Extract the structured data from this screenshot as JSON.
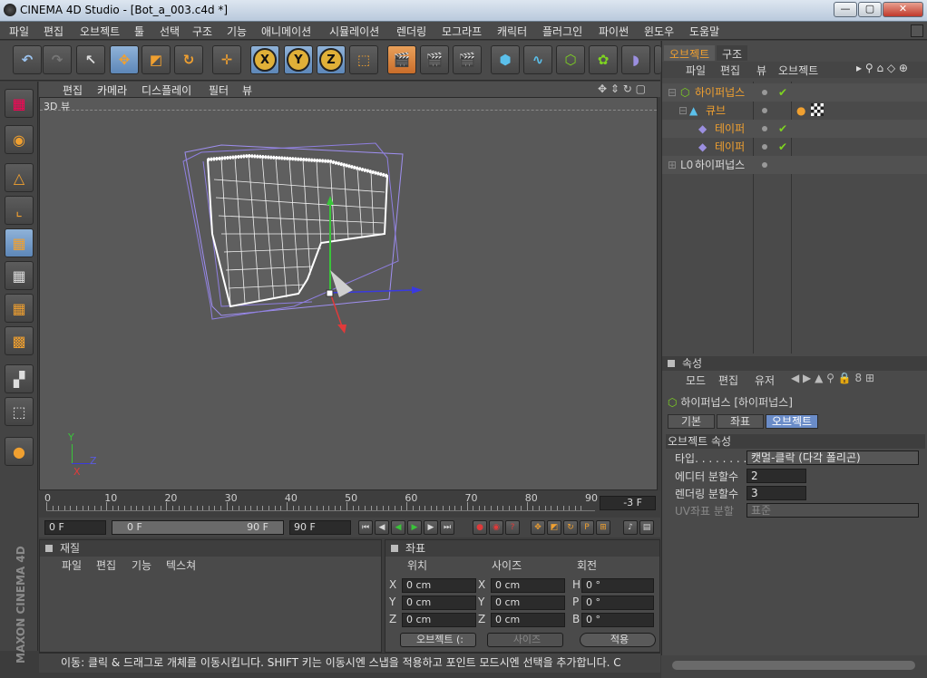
{
  "window": {
    "title": "CINEMA 4D Studio - [Bot_a_003.c4d *]",
    "minimize": "—",
    "maximize": "▢",
    "close": "✕"
  },
  "menu": [
    "파일",
    "편집",
    "오브젝트",
    "툴",
    "선택",
    "구조",
    "기능",
    "애니메이션",
    "시뮬레이션",
    "렌더링",
    "모그라프",
    "캐릭터",
    "플러그인",
    "파이썬",
    "윈도우",
    "도움말"
  ],
  "toolbar": {
    "axis_x": "X",
    "axis_y": "Y",
    "axis_z": "Z"
  },
  "viewport": {
    "menu": [
      "편집",
      "카메라",
      "디스플레이",
      "필터",
      "뷰"
    ],
    "label": "3D 뷰",
    "axis_y": "Y",
    "axis_z": "Z",
    "axis_x": "X"
  },
  "timeline": {
    "ticks": [
      "0",
      "10",
      "20",
      "30",
      "40",
      "50",
      "60",
      "70",
      "80",
      "90"
    ],
    "current_frame": "-3 F"
  },
  "anim": {
    "start": "0 F",
    "range_start": "0 F",
    "range_end": "90 F",
    "end": "90 F"
  },
  "materials": {
    "title": "재질",
    "menu": [
      "파일",
      "편집",
      "기능",
      "텍스쳐"
    ]
  },
  "coords": {
    "title": "좌표",
    "headers": [
      "위치",
      "사이즈",
      "회전"
    ],
    "rows": [
      {
        "a": "X",
        "pos": "0 cm",
        "b": "X",
        "size": "0 cm",
        "c": "H",
        "rot": "0 °"
      },
      {
        "a": "Y",
        "pos": "0 cm",
        "b": "Y",
        "size": "0 cm",
        "c": "P",
        "rot": "0 °"
      },
      {
        "a": "Z",
        "pos": "0 cm",
        "b": "Z",
        "size": "0 cm",
        "c": "B",
        "rot": "0 °"
      }
    ],
    "mode_select": "오브젝트 (:",
    "size_select": "사이즈",
    "apply": "적용"
  },
  "objects": {
    "tabs": [
      "오브젝트",
      "구조"
    ],
    "menu": [
      "파일",
      "편집",
      "뷰",
      "오브젝트"
    ],
    "rows": [
      {
        "name": "하이퍼넙스",
        "color": "#f0a030"
      },
      {
        "name": "큐브",
        "color": "#f0a030"
      },
      {
        "name": "테이퍼",
        "color": "#f0a030"
      },
      {
        "name": "테이퍼",
        "color": "#f0a030"
      },
      {
        "name": "하이퍼넙스",
        "color": "#dcdcdc"
      }
    ]
  },
  "attributes": {
    "title": "속성",
    "menu": [
      "모드",
      "편집",
      "유저"
    ],
    "object_label": "하이퍼넙스 [하이퍼넙스]",
    "subtabs": [
      "기본",
      "좌표",
      "오브젝트"
    ],
    "section": "오브젝트 속성",
    "fields": [
      {
        "label": "타입. . . . . . . . .",
        "value": "캣멀-클락 (다각 폴리곤)"
      },
      {
        "label": "에디터 분할수",
        "value": "2"
      },
      {
        "label": "렌더링 분할수",
        "value": "3"
      },
      {
        "label": "UV좌표 분할",
        "value": "표준"
      }
    ]
  },
  "maxon": "MAXON CINEMA 4D",
  "status": "이동: 클릭 & 드래그로 개체를 이동시킵니다. SHIFT 키는 이동시엔 스냅을 적용하고 포인트 모드시엔 선택을 추가합니다. C"
}
